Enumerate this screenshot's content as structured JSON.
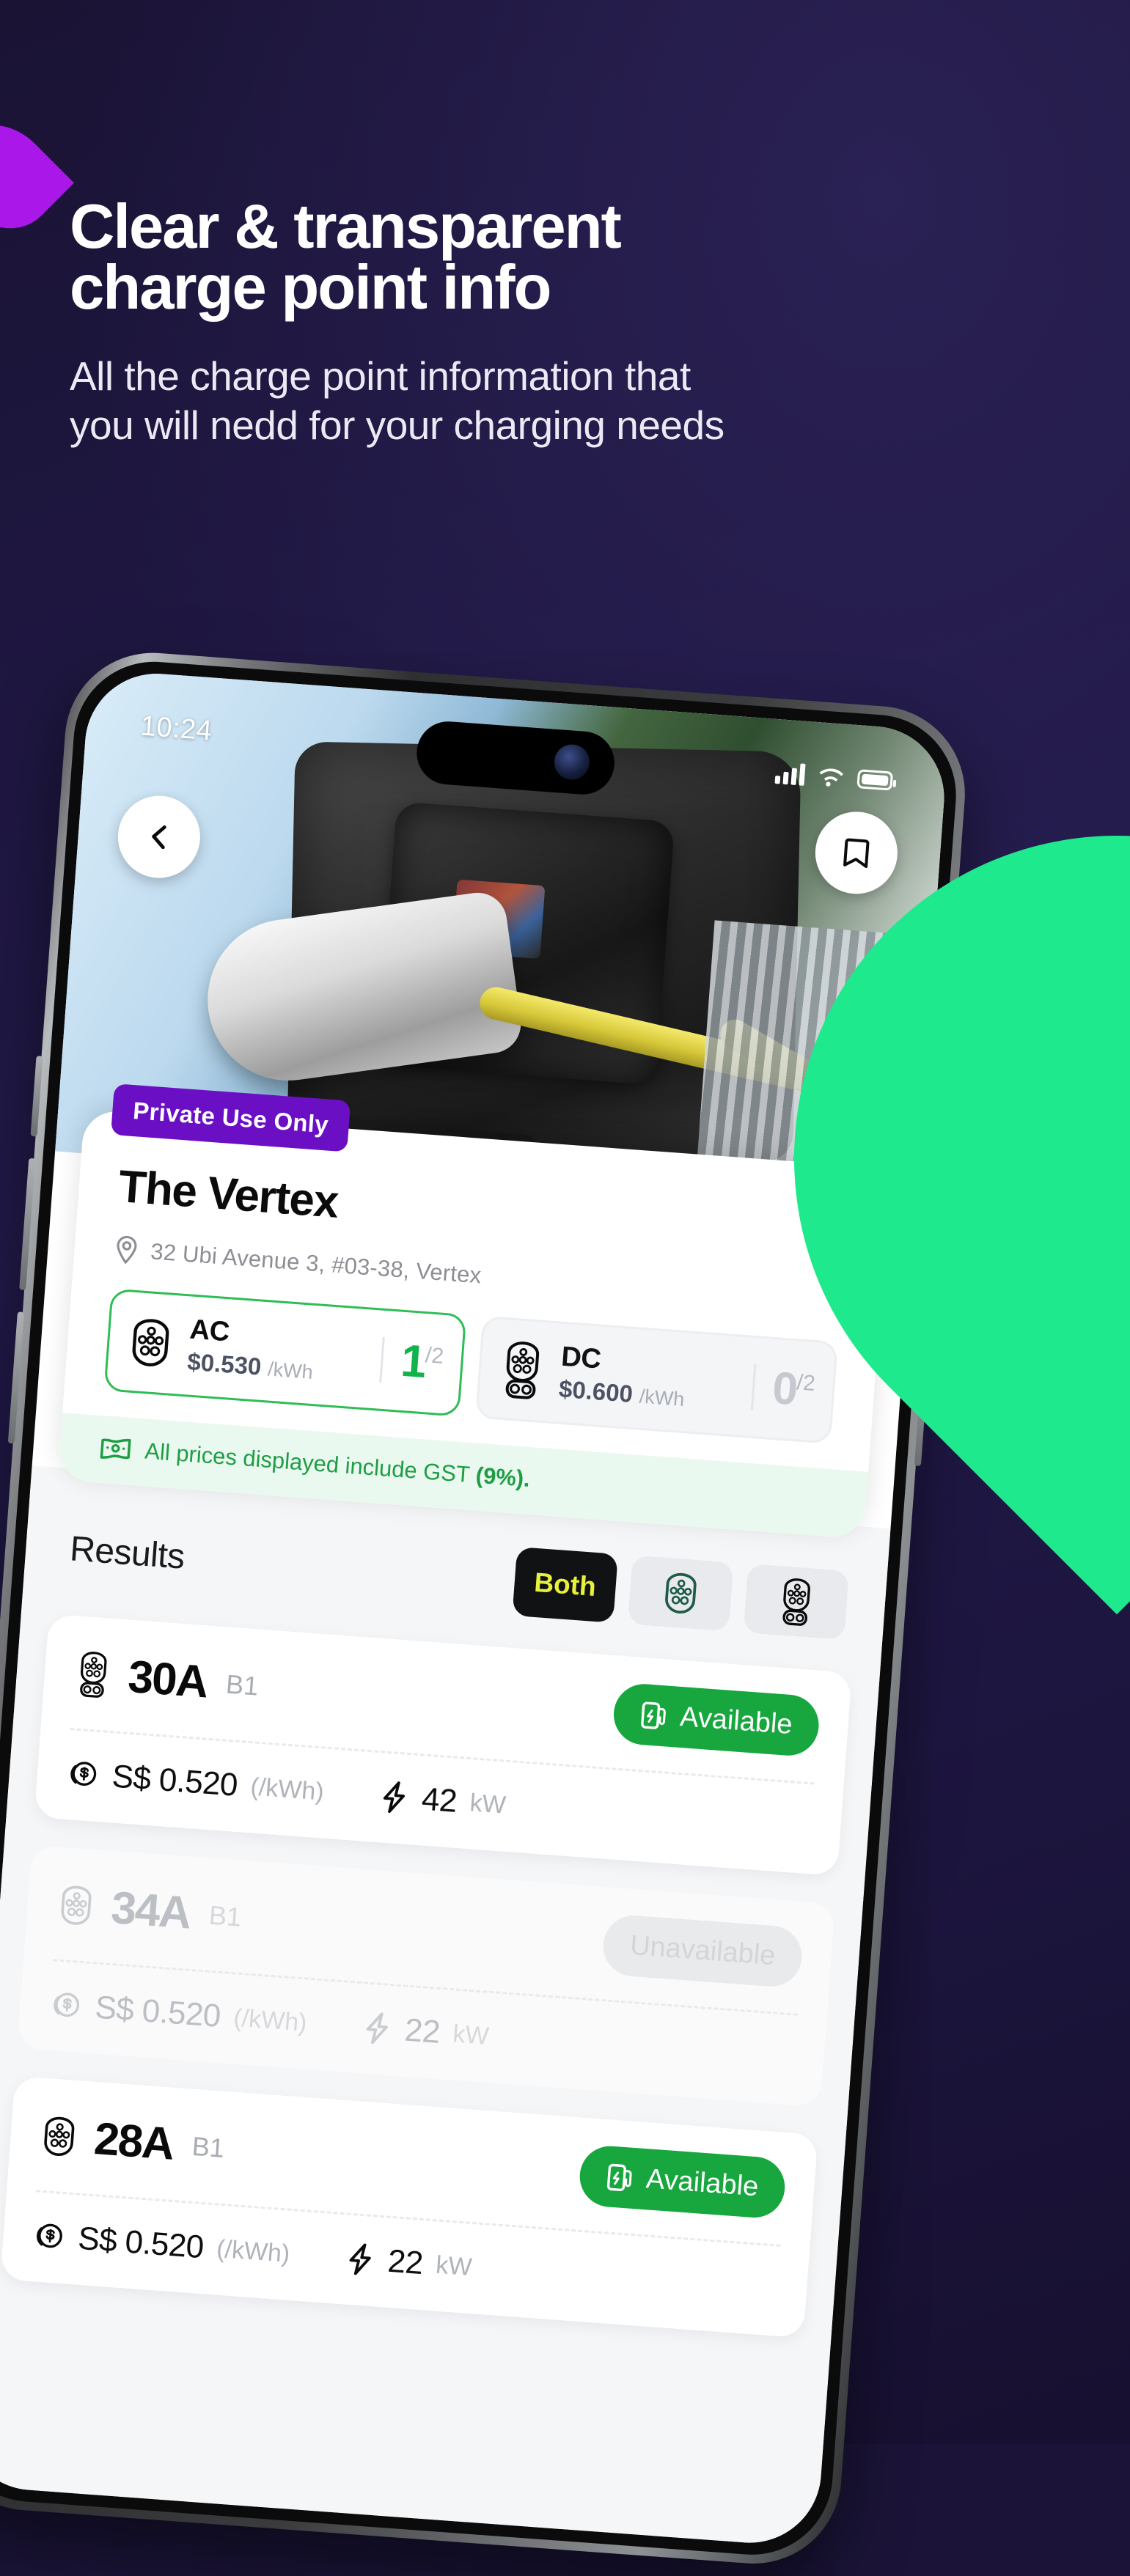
{
  "promo": {
    "headline_line1": "Clear & transparent",
    "headline_line2": "charge point info",
    "subhead_line1": "All the charge point information that",
    "subhead_line2": "you will nedd for your charging needs",
    "accent_purple": "#a918e8",
    "accent_green": "#1fe98d",
    "background": "#1b1438"
  },
  "statusbar": {
    "time": "10:24",
    "signal_icon": "cellular-bars-icon",
    "wifi_icon": "wifi-icon",
    "battery_icon": "battery-icon"
  },
  "hero": {
    "back_icon": "chevron-left-icon",
    "save_icon": "bookmark-icon",
    "carousel": {
      "total": 3,
      "active_index": 0
    }
  },
  "detail": {
    "tag": "Private Use Only",
    "venue": "The Vertex",
    "location_icon": "map-pin-icon",
    "address": "32 Ubi Avenue 3, #03-38, Vertex",
    "connectors": [
      {
        "type": "AC",
        "icon": "ac-connector-icon",
        "price": "$0.530",
        "price_unit": "/kWh",
        "available": "1",
        "total": "/2",
        "selected": true
      },
      {
        "type": "DC",
        "icon": "dc-connector-icon",
        "price": "$0.600",
        "price_unit": "/kWh",
        "available": "0",
        "total": "/2",
        "selected": false
      }
    ],
    "gst_icon": "money-note-icon",
    "gst_text": "All prices displayed include GST ",
    "gst_value": "(9%).",
    "gst_color": "#1f9d45"
  },
  "results": {
    "title": "Results",
    "filters": [
      {
        "label": "Both",
        "icon": "",
        "active": true
      },
      {
        "label": "",
        "icon": "ac-connector-icon",
        "active": false
      },
      {
        "label": "",
        "icon": "dc-connector-icon",
        "active": false
      }
    ],
    "cards": [
      {
        "amps": "30A",
        "bay": "B1",
        "connector_icon": "dc-connector-icon",
        "status": "Available",
        "status_icon": "charger-icon",
        "available": true,
        "price": "S$ 0.520",
        "price_unit": "(/kWh)",
        "price_icon": "coin-icon",
        "power": "42",
        "power_unit": "kW",
        "power_icon": "bolt-icon"
      },
      {
        "amps": "34A",
        "bay": "B1",
        "connector_icon": "ac-connector-icon",
        "status": "Unavailable",
        "status_icon": "",
        "available": false,
        "price": "S$ 0.520",
        "price_unit": "(/kWh)",
        "price_icon": "coin-icon",
        "power": "22",
        "power_unit": "kW",
        "power_icon": "bolt-icon"
      },
      {
        "amps": "28A",
        "bay": "B1",
        "connector_icon": "ac-connector-icon",
        "status": "Available",
        "status_icon": "charger-icon",
        "available": true,
        "price": "S$ 0.520",
        "price_unit": "(/kWh)",
        "price_icon": "coin-icon",
        "power": "22",
        "power_unit": "kW",
        "power_icon": "bolt-icon"
      }
    ]
  }
}
